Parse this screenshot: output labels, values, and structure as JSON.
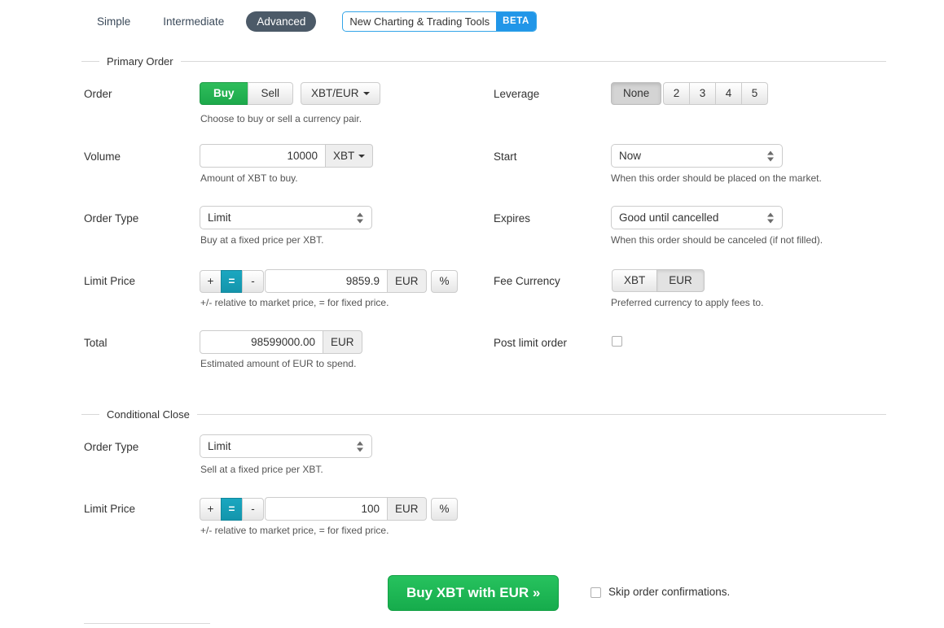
{
  "tabs": [
    {
      "label": "Simple",
      "active": false
    },
    {
      "label": "Intermediate",
      "active": false
    },
    {
      "label": "Advanced",
      "active": true
    }
  ],
  "beta_promo": {
    "text": "New Charting & Trading Tools",
    "badge": "BETA",
    "border_color": "#34a5e8",
    "badge_color": "#2196e8"
  },
  "sections": {
    "primary_order": {
      "legend": "Primary Order"
    },
    "conditional_close": {
      "legend": "Conditional Close"
    }
  },
  "primary_order": {
    "order": {
      "label": "Order",
      "side_options": [
        "Buy",
        "Sell"
      ],
      "side_selected": "Buy",
      "buy_color": "#1da94b",
      "pair_selected": "XBT/EUR",
      "help": "Choose to buy or sell a currency pair."
    },
    "volume": {
      "label": "Volume",
      "value": "10000",
      "unit": "XBT",
      "help": "Amount of XBT to buy."
    },
    "order_type": {
      "label": "Order Type",
      "value": "Limit",
      "help": "Buy at a fixed price per XBT."
    },
    "limit_price": {
      "label": "Limit Price",
      "modes": [
        "+",
        "=",
        "-"
      ],
      "mode_selected": "=",
      "mode_color": "#1495ac",
      "value": "9859.9",
      "currency": "EUR",
      "percent_label": "%",
      "help": "+/- relative to market price, = for fixed price."
    },
    "total": {
      "label": "Total",
      "value": "98599000.00",
      "currency": "EUR",
      "help": "Estimated amount of EUR to spend."
    },
    "leverage": {
      "label": "Leverage",
      "options": [
        "None",
        "2",
        "3",
        "4",
        "5"
      ],
      "selected": "None"
    },
    "start": {
      "label": "Start",
      "value": "Now",
      "help": "When this order should be placed on the market."
    },
    "expires": {
      "label": "Expires",
      "value": "Good until cancelled",
      "help": "When this order should be canceled (if not filled)."
    },
    "fee_currency": {
      "label": "Fee Currency",
      "options": [
        "XBT",
        "EUR"
      ],
      "selected": "EUR",
      "help": "Preferred currency to apply fees to."
    },
    "post_limit_order": {
      "label": "Post limit order",
      "checked": false
    }
  },
  "conditional_close": {
    "order_type": {
      "label": "Order Type",
      "value": "Limit",
      "help": "Sell at a fixed price per XBT."
    },
    "limit_price": {
      "label": "Limit Price",
      "modes": [
        "+",
        "=",
        "-"
      ],
      "mode_selected": "=",
      "value": "100",
      "currency": "EUR",
      "percent_label": "%",
      "help": "+/- relative to market price, = for fixed price."
    }
  },
  "footer": {
    "submit_label": "Buy XBT with EUR »",
    "submit_color": "#16ac4c",
    "skip_label": "Skip order confirmations.",
    "skip_checked": false
  }
}
